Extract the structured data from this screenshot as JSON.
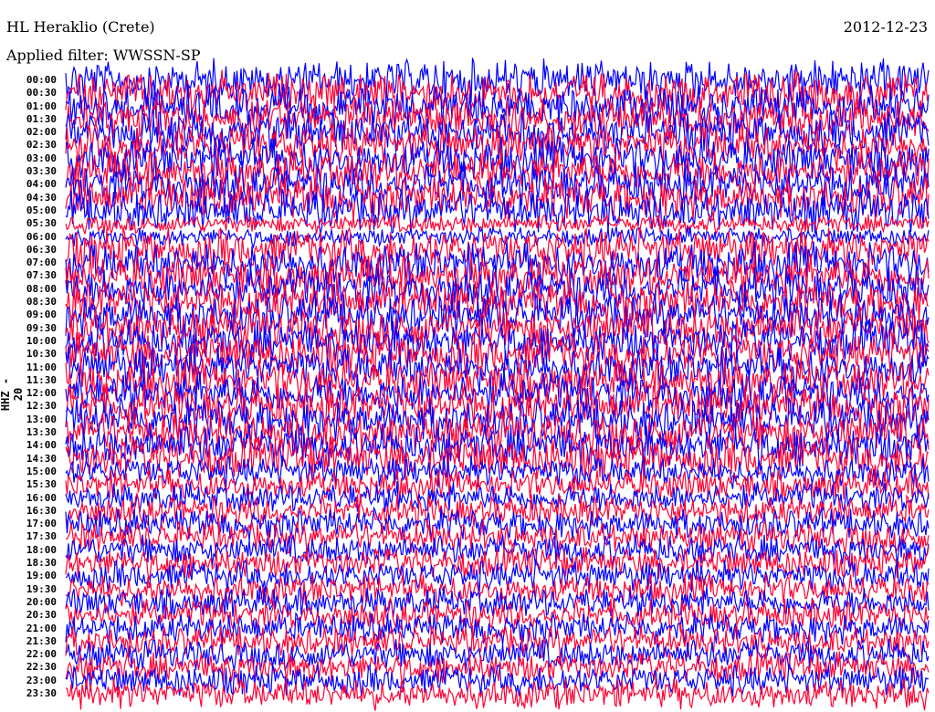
{
  "header": {
    "title": "HL Heraklio (Crete)",
    "date": "2012-12-23",
    "filter": "Applied filter: WWSSN-SP"
  },
  "chart_data": {
    "type": "line",
    "title": "HL Heraklio (Crete)",
    "subtitle": "Applied filter: WWSSN-SP",
    "ylabel": "HHZ - 20",
    "row_labels": [
      "00:00",
      "00:30",
      "01:00",
      "01:30",
      "02:00",
      "02:30",
      "03:00",
      "03:30",
      "04:00",
      "04:30",
      "05:00",
      "05:30",
      "06:00",
      "06:30",
      "07:00",
      "07:30",
      "08:00",
      "08:30",
      "09:00",
      "09:30",
      "10:00",
      "10:30",
      "11:00",
      "11:30",
      "12:00",
      "12:30",
      "13:00",
      "13:30",
      "14:00",
      "14:30",
      "15:00",
      "15:30",
      "16:00",
      "16:30",
      "17:00",
      "17:30",
      "18:00",
      "18:30",
      "19:00",
      "19:30",
      "20:00",
      "20:30",
      "21:00",
      "21:30",
      "22:00",
      "22:30",
      "23:00",
      "23:30"
    ],
    "trace_colors": [
      "#0000ff",
      "#ff0033"
    ],
    "grid": false
  }
}
